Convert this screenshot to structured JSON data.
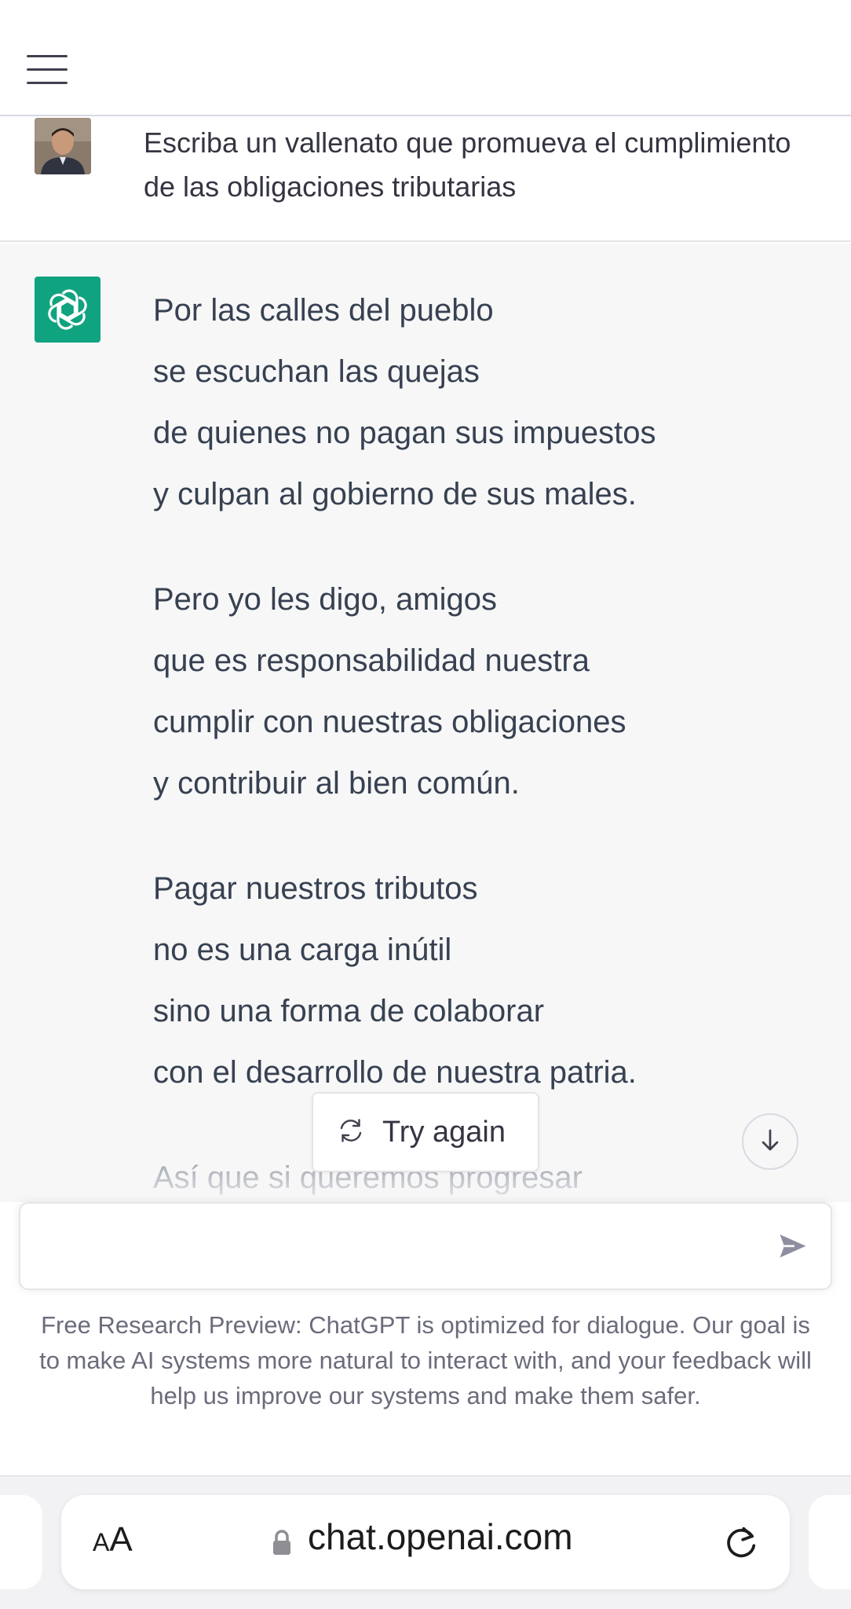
{
  "header": {
    "menu_icon": "hamburger-menu-icon"
  },
  "user_message": {
    "text": "Escriba un vallenato que promueva el cumplimiento de las obligaciones tributarias"
  },
  "assistant_message": {
    "stanzas": [
      [
        "Por las calles del pueblo",
        "se escuchan las quejas",
        "de quienes no pagan sus impuestos",
        "y culpan al gobierno de sus males."
      ],
      [
        "Pero yo les digo, amigos",
        "que es responsabilidad nuestra",
        "cumplir con nuestras obligaciones",
        "y contribuir al bien común."
      ],
      [
        "Pagar nuestros tributos",
        "no es una carga inútil",
        "sino una forma de colaborar",
        "con el desarrollo de nuestra patria."
      ],
      [
        "Así que si queremos progresar"
      ]
    ],
    "accent_color": "#10a37f"
  },
  "controls": {
    "try_again_label": "Try again",
    "try_again_icon": "refresh-icon",
    "scroll_down_icon": "arrow-down-icon",
    "send_icon": "send-icon"
  },
  "composer": {
    "value": "",
    "placeholder": ""
  },
  "disclaimer": "Free Research Preview: ChatGPT is optimized for dialogue. Our goal is to make AI systems more natural to interact with, and your feedback will help us improve our systems and make them safer.",
  "browser": {
    "text_size_label_small": "A",
    "text_size_label_large": "A",
    "url": "chat.openai.com",
    "lock_icon": "lock-icon",
    "reload_icon": "reload-icon"
  }
}
